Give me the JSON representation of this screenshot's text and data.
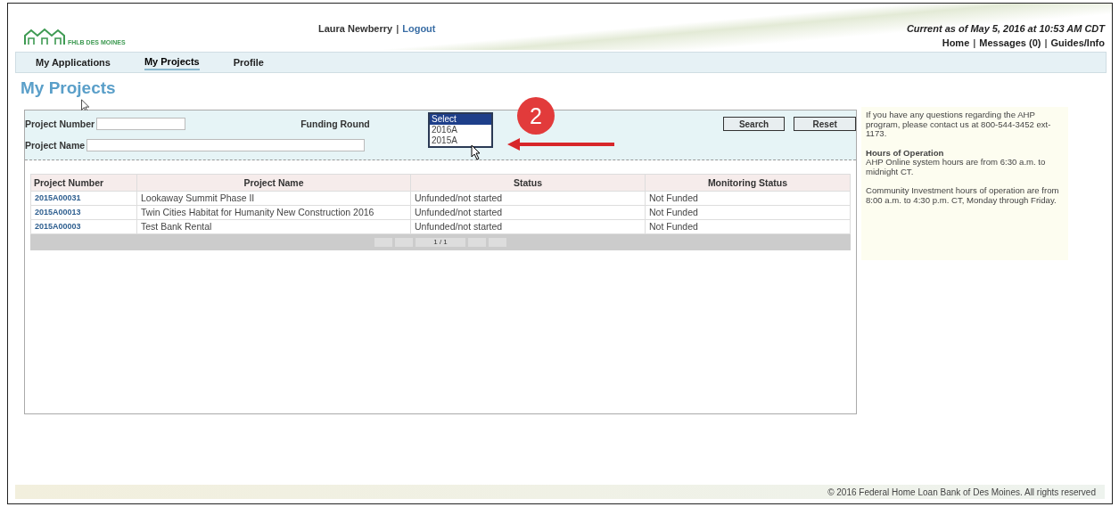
{
  "header": {
    "logo_text": "FHLB DES MOINES",
    "user": "Laura Newberry",
    "separator": "|",
    "logout": "Logout",
    "current_as_of": "Current as of May 5, 2016 at 10:53 AM CDT",
    "links": [
      {
        "label": "Home"
      },
      {
        "label": "Messages (0)"
      },
      {
        "label": "Guides/Info"
      }
    ]
  },
  "nav": [
    {
      "label": "My Applications",
      "selected": false
    },
    {
      "label": "My Projects",
      "selected": true
    },
    {
      "label": "Profile",
      "selected": false
    }
  ],
  "page_title": "My Projects",
  "search": {
    "project_number_label": "Project Number",
    "project_name_label": "Project Name",
    "funding_round_label": "Funding Round",
    "funding_round_options": [
      {
        "label": "Select",
        "selected": true
      },
      {
        "label": "2016A",
        "selected": false
      },
      {
        "label": "2015A",
        "selected": false
      }
    ],
    "search_button": "Search",
    "reset_button": "Reset"
  },
  "annotation": {
    "step": "2"
  },
  "table": {
    "columns": [
      "Project Number",
      "Project Name",
      "Status",
      "Monitoring Status"
    ],
    "rows": [
      [
        "2015A00031",
        "Lookaway Summit Phase II",
        "Unfunded/not started",
        "Not Funded"
      ],
      [
        "2015A00013",
        "Twin Cities Habitat for Humanity New Construction 2016",
        "Unfunded/not started",
        "Not Funded"
      ],
      [
        "2015A00003",
        "Test Bank Rental",
        "Unfunded/not started",
        "Not Funded"
      ]
    ],
    "pager": "1 / 1"
  },
  "info": {
    "contact": "If you have any questions regarding the AHP program, please contact us at 800-544-3452 ext-1173.",
    "hours_title": "Hours of Operation",
    "hours_text": "AHP Online system hours are from 6:30 a.m. to midnight CT.",
    "community_text": "Community Investment hours of operation are from 8:00 a.m. to 4:30 p.m. CT, Monday through Friday."
  },
  "footer": "© 2016 Federal Home Loan Bank of Des Moines.  All rights reserved"
}
